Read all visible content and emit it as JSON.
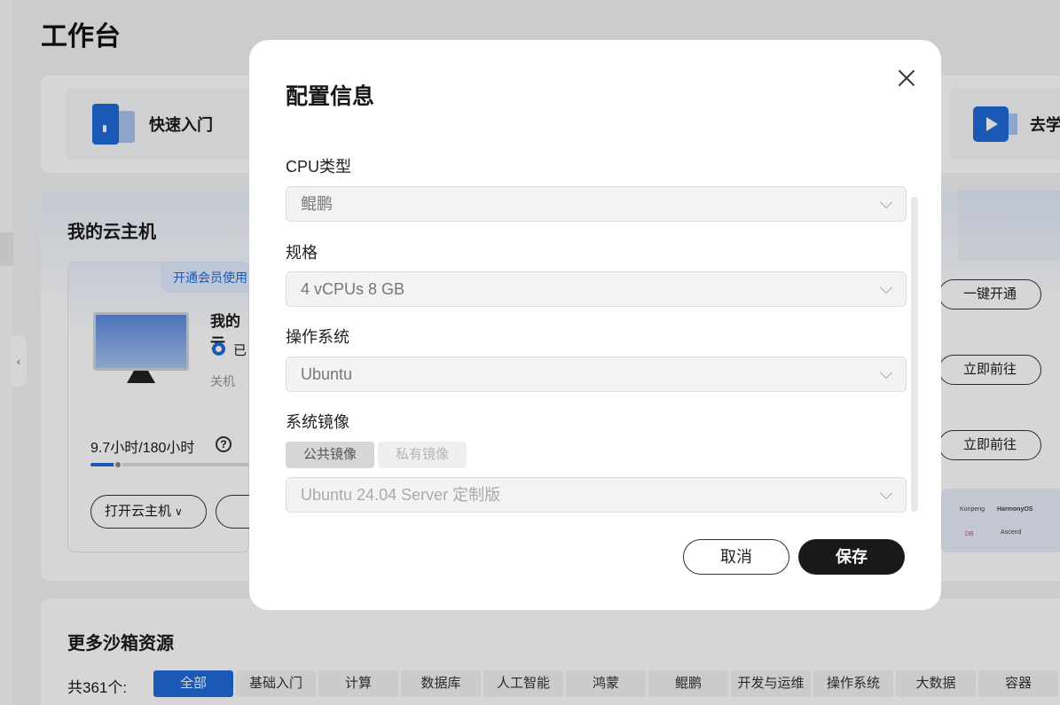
{
  "workspace": {
    "title": "工作台"
  },
  "quick_links": [
    {
      "label": "快速入门",
      "icon": "doc-icon"
    },
    {
      "label": "去学",
      "icon": "video-icon"
    }
  ],
  "my_hosts": {
    "title": "我的云主机",
    "vip_tag": "开通会员使用",
    "host_name": "我的云",
    "status_text": "已",
    "power_state": "关机",
    "usage_text": "9.7小时/180小时",
    "usage_fraction": 0.054,
    "open_button": "打开云主机",
    "right_buttons": [
      "一键开通",
      "立即前往",
      "立即前往"
    ]
  },
  "more": {
    "title": "更多沙箱资源",
    "count_label": "共361个:",
    "filters": [
      "全部",
      "基础入门",
      "计算",
      "数据库",
      "人工智能",
      "鸿蒙",
      "鲲鹏",
      "开发与运维",
      "操作系统",
      "大数据",
      "容器"
    ],
    "active_filter": 0
  },
  "banner": {
    "labels": [
      "Kunpeng",
      "HarmonyOS",
      "Ascend",
      "DB"
    ]
  },
  "modal": {
    "title": "配置信息",
    "cpu_label": "CPU类型",
    "cpu_value": "鲲鹏",
    "spec_label": "规格",
    "spec_value": "4 vCPUs 8 GB",
    "os_label": "操作系统",
    "os_value": "Ubuntu",
    "image_label": "系统镜像",
    "image_tabs": [
      "公共镜像",
      "私有镜像"
    ],
    "image_value": "Ubuntu 24.04 Server 定制版",
    "cancel": "取消",
    "save": "保存"
  },
  "colors": {
    "accent": "#1f6bd8",
    "primary_button": "#191919"
  }
}
